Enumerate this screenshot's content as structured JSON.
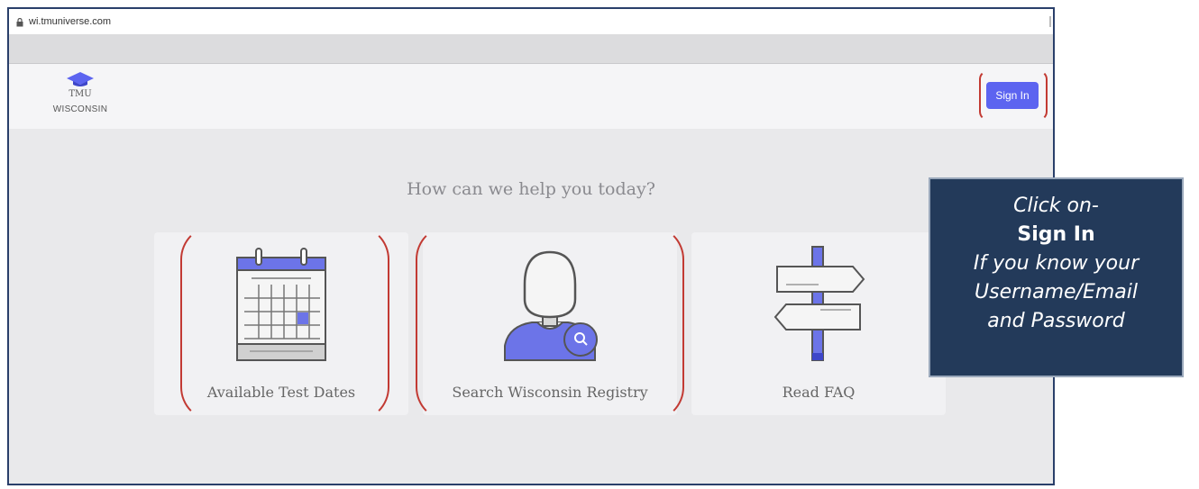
{
  "browser": {
    "url": "wi.tmuniverse.com"
  },
  "header": {
    "logo_text": "TMU",
    "logo_subtext": "WISCONSIN",
    "signin_label": "Sign In"
  },
  "main": {
    "question": "How can we help you today?",
    "cards": [
      {
        "label": "Available Test Dates",
        "icon": "calendar-icon"
      },
      {
        "label": "Search Wisconsin Registry",
        "icon": "person-search-icon"
      },
      {
        "label": "Read FAQ",
        "icon": "signpost-icon"
      }
    ]
  },
  "callout": {
    "line1": "Click on-",
    "line2": "Sign In",
    "line3": "If you know your",
    "line4": "Username/Email",
    "line5": "and Password"
  },
  "colors": {
    "accent": "#5c64f0",
    "annotation_red": "#c23a33",
    "callout_bg": "#233a5a"
  }
}
